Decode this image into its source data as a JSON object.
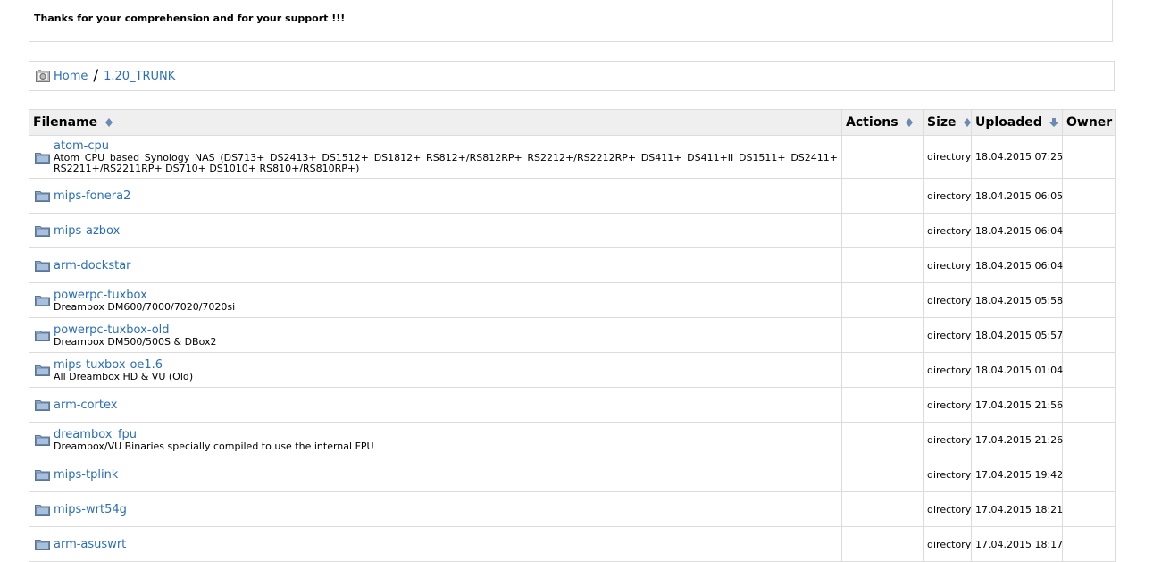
{
  "notice": {
    "text": "Thanks for your comprehension and for your support !!!"
  },
  "breadcrumb": {
    "home": "Home",
    "separator": "/",
    "current": "1.20_TRUNK"
  },
  "table": {
    "headers": {
      "filename": "Filename",
      "actions": "Actions",
      "size": "Size",
      "uploaded": "Uploaded",
      "owner": "Owner"
    },
    "rows": [
      {
        "name": "atom-cpu",
        "desc": "Atom CPU based Synology NAS (DS713+ DS2413+ DS1512+ DS1812+ RS812+/RS812RP+ RS2212+/RS2212RP+ DS411+ DS411+II DS1511+ DS2411+ RS2211+/RS2211RP+ DS710+ DS1010+ RS810+/RS810RP+)",
        "size": "directory",
        "uploaded": "18.04.2015 07:25"
      },
      {
        "name": "mips-fonera2",
        "desc": "",
        "size": "directory",
        "uploaded": "18.04.2015 06:05"
      },
      {
        "name": "mips-azbox",
        "desc": "",
        "size": "directory",
        "uploaded": "18.04.2015 06:04"
      },
      {
        "name": "arm-dockstar",
        "desc": "",
        "size": "directory",
        "uploaded": "18.04.2015 06:04"
      },
      {
        "name": "powerpc-tuxbox",
        "desc": "Dreambox DM600/7000/7020/7020si",
        "size": "directory",
        "uploaded": "18.04.2015 05:58"
      },
      {
        "name": "powerpc-tuxbox-old",
        "desc": "Dreambox DM500/500S & DBox2",
        "size": "directory",
        "uploaded": "18.04.2015 05:57"
      },
      {
        "name": "mips-tuxbox-oe1.6",
        "desc": "All Dreambox HD & VU (Old)",
        "size": "directory",
        "uploaded": "18.04.2015 01:04"
      },
      {
        "name": "arm-cortex",
        "desc": "",
        "size": "directory",
        "uploaded": "17.04.2015 21:56"
      },
      {
        "name": "dreambox_fpu",
        "desc": "Dreambox/VU Binaries specially compiled to use the internal FPU",
        "size": "directory",
        "uploaded": "17.04.2015 21:26"
      },
      {
        "name": "mips-tplink",
        "desc": "",
        "size": "directory",
        "uploaded": "17.04.2015 19:42"
      },
      {
        "name": "mips-wrt54g",
        "desc": "",
        "size": "directory",
        "uploaded": "17.04.2015 18:21"
      },
      {
        "name": "arm-asuswrt",
        "desc": "",
        "size": "directory",
        "uploaded": "17.04.2015 18:17"
      }
    ]
  },
  "icons": {
    "home": "home-icon",
    "folder": "folder-icon",
    "sort": "sort-icon",
    "sort_desc": "sort-desc-icon"
  },
  "colors": {
    "link": "#2a6ebb",
    "header_bg": "#efefef",
    "border": "#dcdcdc",
    "folder": "#6b8bb3"
  }
}
